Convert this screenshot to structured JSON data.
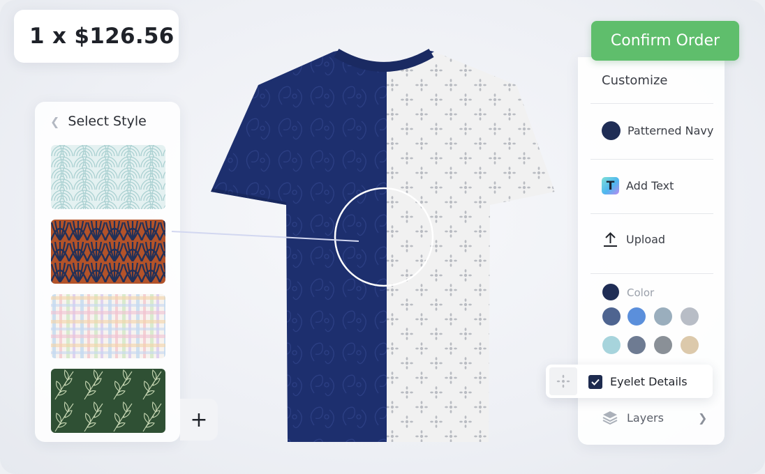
{
  "order": {
    "price_label": "1 x $126.56"
  },
  "style_panel": {
    "title": "Select Style",
    "back_icon": "chevron-left-icon",
    "styles": [
      {
        "name": "seigaiha-waves",
        "selected": false
      },
      {
        "name": "art-deco-fans",
        "selected": true
      },
      {
        "name": "pastel-plaid",
        "selected": false
      },
      {
        "name": "botanical-leaves",
        "selected": false
      }
    ],
    "add_icon": "plus-icon"
  },
  "actions": {
    "confirm_label": "Confirm Order"
  },
  "customize": {
    "title": "Customize",
    "items": [
      {
        "icon": "navy-swatch-icon",
        "label": "Patterned Navy"
      },
      {
        "icon": "text-tool-icon",
        "label": "Add Text",
        "glyph": "T"
      },
      {
        "icon": "upload-icon",
        "label": "Upload"
      }
    ],
    "color_label": "Color",
    "selected_color": "#1f2d55",
    "palette": [
      "#4e6490",
      "#5b8fdb",
      "#9aaebd",
      "#b8bdc6",
      "#a7d4dc",
      "#6e7b92",
      "#8a9097",
      "#dcc9ab"
    ]
  },
  "eyelet": {
    "label": "Eyelet Details",
    "checked": true
  },
  "layers": {
    "label": "Layers"
  },
  "colors": {
    "accent_green": "#5fbe6c",
    "navy": "#1f2d55"
  }
}
